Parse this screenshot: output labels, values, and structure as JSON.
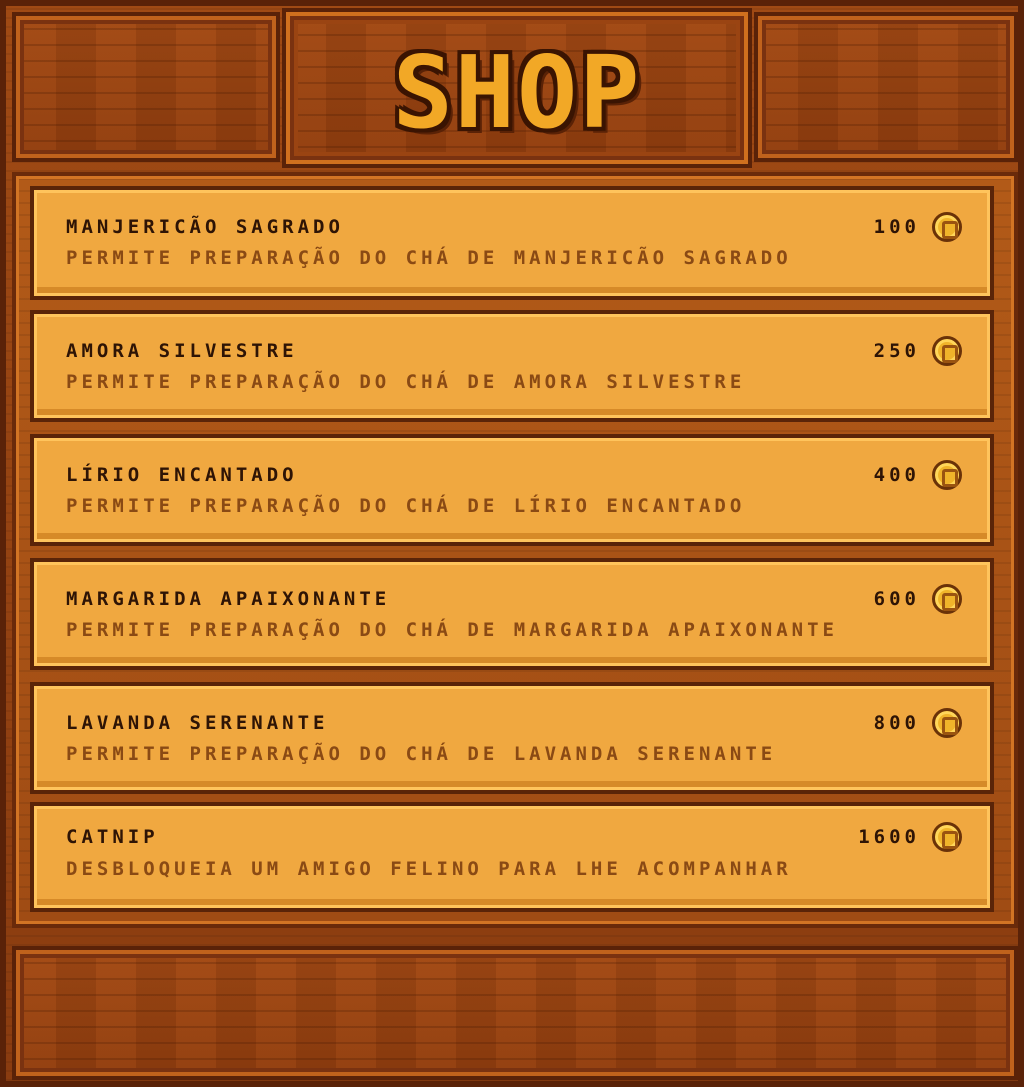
{
  "header": {
    "title": "SHOP"
  },
  "currency": {
    "icon": "coin-icon",
    "color": "#f0b42a"
  },
  "items": [
    {
      "name": "Manjericão Sagrado",
      "description": "Permite preparação do chá de manjericão sagrado",
      "price": "100"
    },
    {
      "name": "Amora Silvestre",
      "description": "Permite preparação do chá de amora silvestre",
      "price": "250"
    },
    {
      "name": "Lírio Encantado",
      "description": "Permite preparação do chá de lírio encantado",
      "price": "400"
    },
    {
      "name": "Margarida Apaixonante",
      "description": "Permite preparação do chá de margarida apaixonante",
      "price": "600"
    },
    {
      "name": "Lavanda Serenante",
      "description": "Permite preparação do chá de lavanda serenante",
      "price": "800"
    },
    {
      "name": "Catnip",
      "description": "Desbloqueia um amigo felino para lhe acompanhar",
      "price": "1600"
    }
  ]
}
